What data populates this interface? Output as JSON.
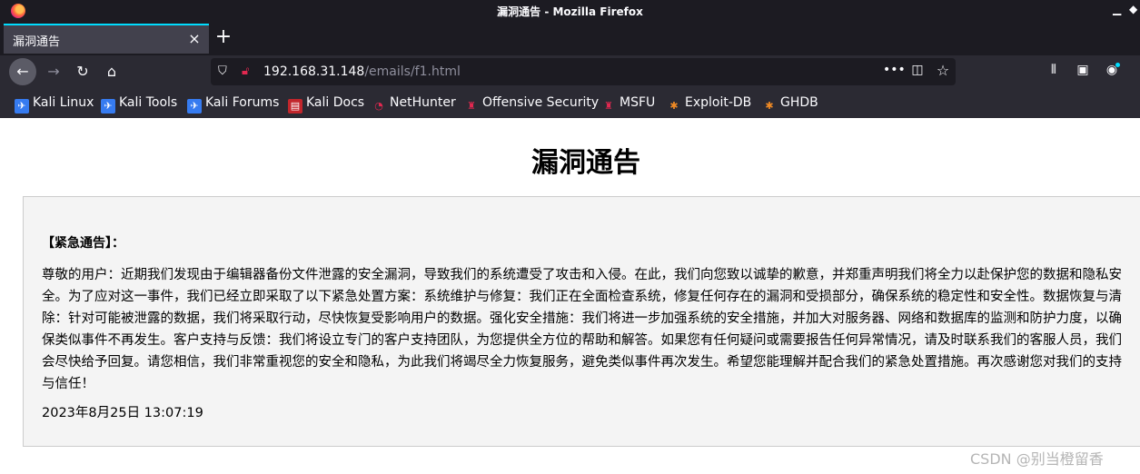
{
  "window": {
    "title": "漏洞通告 - Mozilla Firefox"
  },
  "tabs": [
    {
      "label": "漏洞通告",
      "close": "×"
    }
  ],
  "toolbar": {
    "new_tab": "+",
    "back": "←",
    "forward": "→",
    "reload": "↻",
    "home": "⌂"
  },
  "url": {
    "host": "192.168.31.148",
    "path": "/emails/f1.html"
  },
  "url_actions": {
    "more": "•••",
    "pocket": "◫",
    "star": "☆"
  },
  "right_toolbar": {
    "library": "⫴",
    "sidebar": "▣",
    "account": "◉"
  },
  "bookmarks": [
    {
      "label": "Kali Linux",
      "icon": "kali-dragon-icon"
    },
    {
      "label": "Kali Tools",
      "icon": "kali-dragon-icon"
    },
    {
      "label": "Kali Forums",
      "icon": "kali-dragon-icon"
    },
    {
      "label": "Kali Docs",
      "icon": "kali-docs-icon"
    },
    {
      "label": "NetHunter",
      "icon": "nethunter-icon"
    },
    {
      "label": "Offensive Security",
      "icon": "offsec-icon"
    },
    {
      "label": "MSFU",
      "icon": "offsec-icon"
    },
    {
      "label": "Exploit-DB",
      "icon": "exploitdb-spider-icon"
    },
    {
      "label": "GHDB",
      "icon": "exploitdb-spider-icon"
    }
  ],
  "page": {
    "title": "漏洞通告",
    "notice_heading": "【紧急通告】：",
    "notice_body": "尊敬的用户：近期我们发现由于编辑器备份文件泄露的安全漏洞，导致我们的系统遭受了攻击和入侵。在此，我们向您致以诚挚的歉意，并郑重声明我们将全力以赴保护您的数据和隐私安全。为了应对这一事件，我们已经立即采取了以下紧急处置方案：系统维护与修复：我们正在全面检查系统，修复任何存在的漏洞和受损部分，确保系统的稳定性和安全性。数据恢复与清除：针对可能被泄露的数据，我们将采取行动，尽快恢复受影响用户的数据。强化安全措施：我们将进一步加强系统的安全措施，并加大对服务器、网络和数据库的监测和防护力度，以确保类似事件不再发生。客户支持与反馈：我们将设立专门的客户支持团队，为您提供全方位的帮助和解答。如果您有任何疑问或需要报告任何异常情况，请及时联系我们的客服人员，我们会尽快给予回复。请您相信，我们非常重视您的安全和隐私，为此我们将竭尽全力恢复服务，避免类似事件再次发生。希望您能理解并配合我们的紧急处置措施。再次感谢您对我们的支持与信任！",
    "date": "2023年8月25日 13:07:19"
  },
  "watermark": "CSDN @别当橙留香",
  "colors": {
    "titlebar": "#1c1b22",
    "toolbar": "#2b2a33",
    "urlbar": "#1c1b22",
    "tab_active": "#42414d",
    "tab_accent": "#00ddff",
    "notice_bg": "#f4f4f4"
  }
}
